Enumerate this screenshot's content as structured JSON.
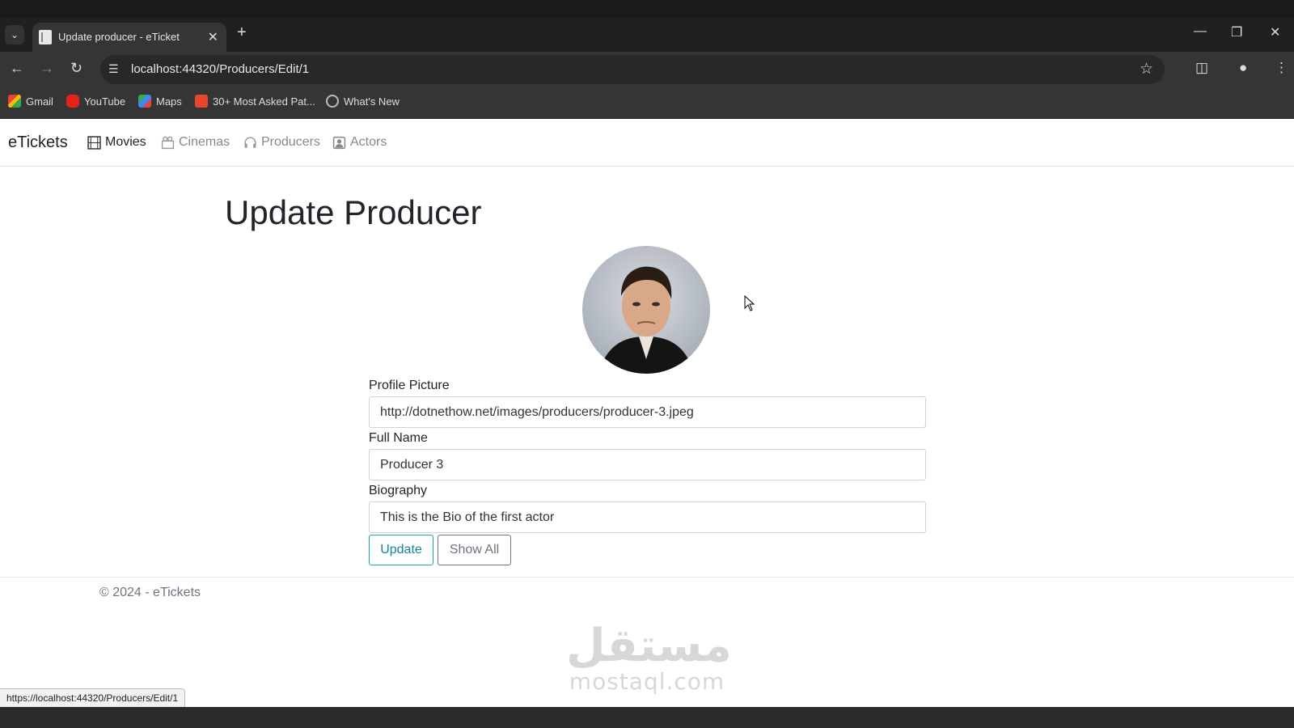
{
  "browser": {
    "tab_title": "Update producer - eTicket",
    "url": "localhost:44320/Producers/Edit/1",
    "status_url": "https://localhost:44320/Producers/Edit/1",
    "bookmarks": [
      {
        "label": "Gmail",
        "icon": "gmail-icon"
      },
      {
        "label": "YouTube",
        "icon": "youtube-icon"
      },
      {
        "label": "Maps",
        "icon": "maps-icon"
      },
      {
        "label": "30+ Most Asked Pat...",
        "icon": "bookmark-site-icon"
      },
      {
        "label": "What's New",
        "icon": "whats-new-icon"
      }
    ]
  },
  "navbar": {
    "brand": "eTickets",
    "links": [
      {
        "label": "Movies",
        "icon": "film-icon",
        "active": true
      },
      {
        "label": "Cinemas",
        "icon": "building-icon",
        "active": false
      },
      {
        "label": "Producers",
        "icon": "headset-icon",
        "active": false
      },
      {
        "label": "Actors",
        "icon": "person-badge-icon",
        "active": false
      }
    ]
  },
  "page": {
    "title": "Update Producer",
    "form": {
      "profile_picture": {
        "label": "Profile Picture",
        "value": "http://dotnethow.net/images/producers/producer-3.jpeg"
      },
      "full_name": {
        "label": "Full Name",
        "value": "Producer 3"
      },
      "biography": {
        "label": "Biography",
        "value": "This is the Bio of the first actor"
      },
      "update_label": "Update",
      "show_all_label": "Show All"
    }
  },
  "footer": {
    "text": "© 2024 - eTickets"
  },
  "watermark": {
    "arabic": "مستقل",
    "latin": "mostaql.com"
  },
  "colors": {
    "accent_info": "#17a2b8",
    "secondary": "#6c757d",
    "browser_dark": "#202020"
  }
}
